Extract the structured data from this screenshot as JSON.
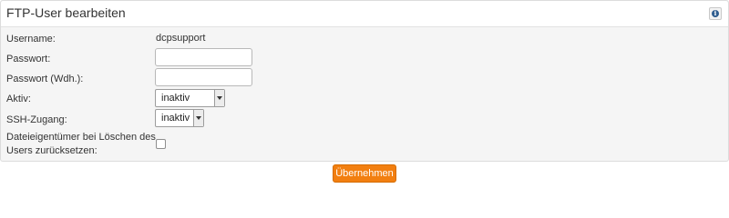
{
  "panel": {
    "title": "FTP-User bearbeiten",
    "info_icon": "info-icon",
    "info_glyph": "i"
  },
  "form": {
    "username": {
      "label": "Username:",
      "value": "dcpsupport"
    },
    "password": {
      "label": "Passwort:",
      "value": ""
    },
    "password_repeat": {
      "label": "Passwort (Wdh.):",
      "value": ""
    },
    "active": {
      "label": "Aktiv:",
      "selected": "inaktiv"
    },
    "ssh_access": {
      "label": "SSH-Zugang:",
      "selected": "inaktiv"
    },
    "reset_owner": {
      "label_line1": "Dateieigentümer bei Löschen des",
      "label_line2": "Users zurücksetzen:",
      "checked": false
    }
  },
  "actions": {
    "submit_label": "Übernehmen"
  },
  "colors": {
    "accent": "#f27f10",
    "info_icon": "#2f5d8f",
    "panel_background": "#f5f5f5"
  }
}
